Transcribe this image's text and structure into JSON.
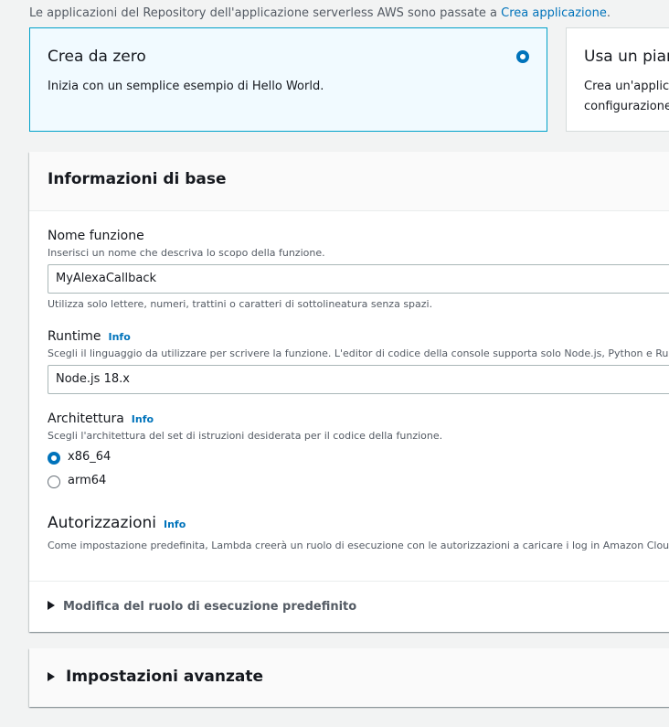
{
  "notice": {
    "text": "Le applicazioni del Repository dell'applicazione serverless AWS sono passate a ",
    "link": "Crea applicazione",
    "tail": "."
  },
  "tiles": [
    {
      "title": "Crea da zero",
      "desc": "Inizia con un semplice esempio di Hello World.",
      "selected": true
    },
    {
      "title": "Usa un pian",
      "desc_line1": "Crea un'applica",
      "desc_line2": "configurazione",
      "selected": false
    }
  ],
  "basic": {
    "title": "Informazioni di base",
    "function_name": {
      "label": "Nome funzione",
      "desc": "Inserisci un nome che descriva lo scopo della funzione.",
      "value": "MyAlexaCallback",
      "hint": "Utilizza solo lettere, numeri, trattini o caratteri di sottolineatura senza spazi."
    },
    "runtime": {
      "label": "Runtime",
      "info": "Info",
      "desc": "Scegli il linguaggio da utilizzare per scrivere la funzione. L'editor di codice della console supporta solo Node.js, Python e Ruby.",
      "value": "Node.js 18.x"
    },
    "architecture": {
      "label": "Architettura",
      "info": "Info",
      "desc": "Scegli l'architettura del set di istruzioni desiderata per il codice della funzione.",
      "options": [
        "x86_64",
        "arm64"
      ],
      "selected": "x86_64"
    },
    "permissions": {
      "label": "Autorizzazioni",
      "info": "Info",
      "desc": "Come impostazione predefinita, Lambda creerà un ruolo di esecuzione con le autorizzazioni a caricare i log in Amazon CloudW"
    },
    "role_expander": "Modifica del ruolo di esecuzione predefinito"
  },
  "advanced": {
    "title": "Impostazioni avanzate"
  },
  "colors": {
    "accent": "#0073bb",
    "selected_bg": "#f1faff",
    "selected_border": "#00a1c9",
    "page_bg": "#f2f3f3"
  }
}
